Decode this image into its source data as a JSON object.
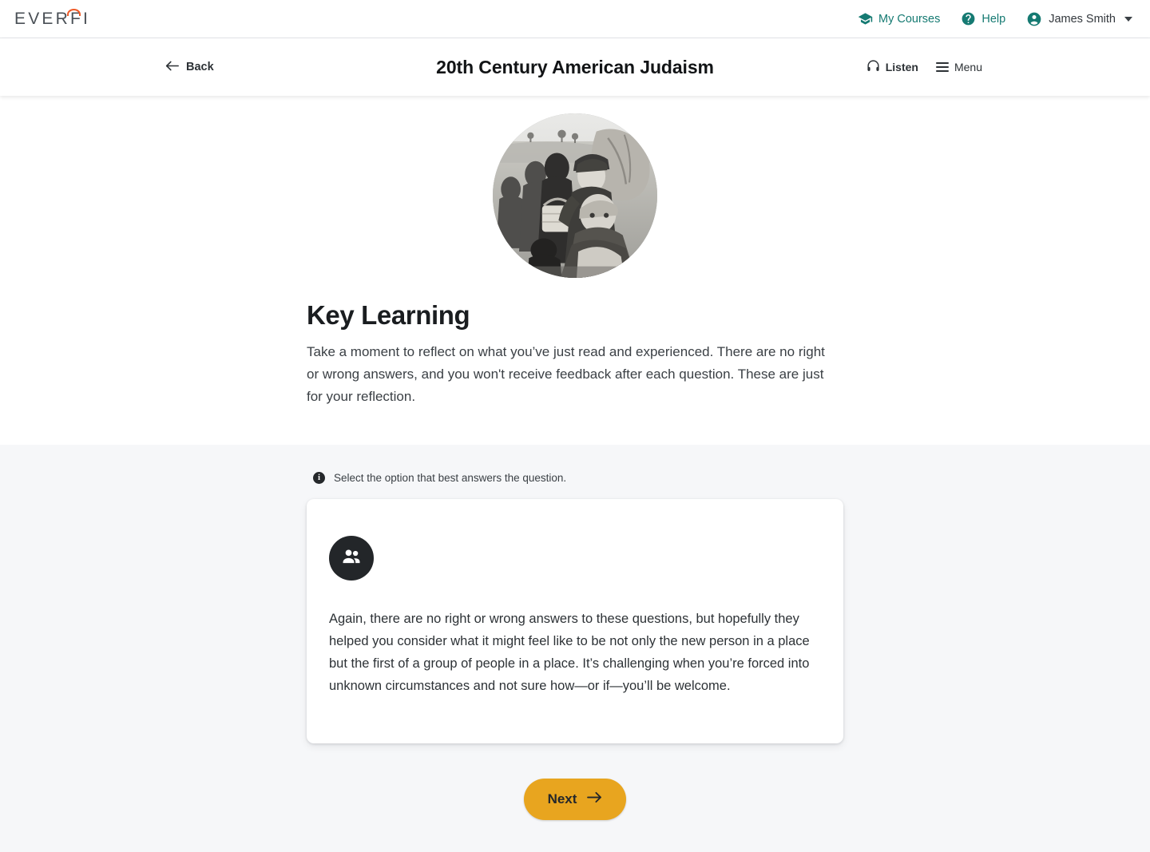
{
  "top_bar": {
    "logo_text": "EVERFI",
    "nav": [
      {
        "label": "My Courses",
        "icon": "graduation-cap-icon"
      },
      {
        "label": "Help",
        "icon": "question-circle-icon"
      },
      {
        "label": "James Smith",
        "icon": "account-circle-icon"
      }
    ],
    "accent_color": "#157a72"
  },
  "course_header": {
    "back_label": "Back",
    "title": "20th Century American Judaism",
    "listen_label": "Listen",
    "menu_label": "Menu"
  },
  "hero": {
    "image_alt": "black-and-white historical photograph of refugees carrying bundles and baskets in a field",
    "heading": "Key Learning",
    "body": "Take a moment to reflect on what you’ve just read and experienced. There are no right or wrong answers, and you won't receive feedback after each question. These are just for your reflection."
  },
  "question_section": {
    "instruction": "Select the option that best answers the question.",
    "card": {
      "icon": "people-group-icon",
      "text": "Again, there are no right or wrong answers to these questions, but hopefully they helped you consider what it might feel like to be not only the new person in a place but the first of a group of people in a place. It’s challenging when you’re forced into unknown circumstances and not sure how—or if—you’ll be welcome."
    },
    "next_label": "Next",
    "next_color": "#e8a51f",
    "background_color": "#f6f7f9"
  }
}
